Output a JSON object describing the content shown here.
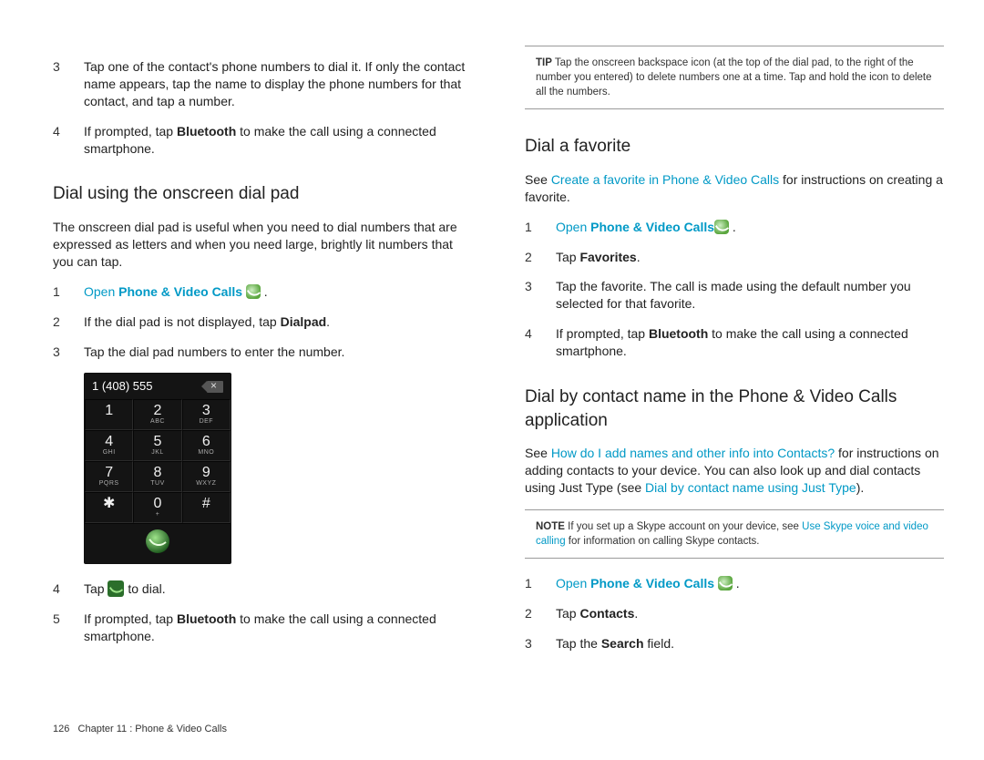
{
  "footer": {
    "page": "126",
    "chapter": "Chapter 11 : Phone & Video Calls"
  },
  "left": {
    "step3": "Tap one of the contact's phone numbers to dial it. If only the contact name appears, tap the name to display the phone numbers for that contact, and tap a number.",
    "step4a": "If prompted, tap ",
    "step4b": "Bluetooth",
    "step4c": " to make the call using a connected smartphone.",
    "h1": "Dial using the onscreen dial pad",
    "para1": "The onscreen dial pad is useful when you need to dial numbers that are expressed as letters and when you need large, brightly lit numbers that you can tap.",
    "s1_open": "Open",
    "s1_app": " Phone & Video Calls",
    "s1_dot": " .",
    "s2a": "If the dial pad is not displayed, tap ",
    "s2b": "Dialpad",
    "s2c": ".",
    "s3": "Tap the dial pad numbers to enter the number.",
    "dialpad": {
      "entered": "1 (408) 555",
      "keys": [
        {
          "main": "1",
          "sub": "  "
        },
        {
          "main": "2",
          "sub": "ABC"
        },
        {
          "main": "3",
          "sub": "DEF"
        },
        {
          "main": "4",
          "sub": "GHI"
        },
        {
          "main": "5",
          "sub": "JKL"
        },
        {
          "main": "6",
          "sub": "MNO"
        },
        {
          "main": "7",
          "sub": "PQRS"
        },
        {
          "main": "8",
          "sub": "TUV"
        },
        {
          "main": "9",
          "sub": "WXYZ"
        },
        {
          "main": "✱",
          "sub": ""
        },
        {
          "main": "0",
          "sub": "+"
        },
        {
          "main": "#",
          "sub": ""
        }
      ]
    },
    "s4a": "Tap ",
    "s4b": " to dial.",
    "s5a": "If prompted, tap ",
    "s5b": "Bluetooth",
    "s5c": " to make the call using a connected smartphone."
  },
  "right": {
    "tipLabel": "TIP",
    "tipText": " Tap the onscreen backspace icon (at the top of the dial pad, to the right of the number you entered) to delete numbers one at a time. Tap and hold the icon to delete all the numbers.",
    "h1": "Dial a favorite",
    "p1a": "See ",
    "p1link": "Create a favorite in Phone & Video Calls",
    "p1b": " for instructions on creating a favorite.",
    "fs1_open": "Open",
    "fs1_app": " Phone & Video Calls",
    "fs1_dot": " .",
    "fs2a": "Tap ",
    "fs2b": "Favorites",
    "fs2c": ".",
    "fs3": "Tap the favorite. The call is made using the default number you selected for that favorite.",
    "fs4a": "If prompted, tap ",
    "fs4b": "Bluetooth",
    "fs4c": " to make the call using a connected smartphone.",
    "h2": "Dial by contact name in the Phone & Video Calls application",
    "p2a": "See ",
    "p2link1": "How do I add names and other info into Contacts?",
    "p2b": " for instructions on adding contacts to your device. You can also look up and dial contacts using Just Type (see ",
    "p2link2": "Dial by contact name using Just Type",
    "p2c": ").",
    "noteLabel": "NOTE",
    "noteTextA": " If you set up a Skype account on your device, see ",
    "noteLink": "Use Skype voice and video calling",
    "noteTextB": " for information on calling Skype contacts.",
    "cs1_open": "Open",
    "cs1_app": " Phone & Video Calls",
    "cs1_dot": " .",
    "cs2a": "Tap ",
    "cs2b": "Contacts",
    "cs2c": ".",
    "cs3a": "Tap the ",
    "cs3b": "Search",
    "cs3c": " field."
  }
}
